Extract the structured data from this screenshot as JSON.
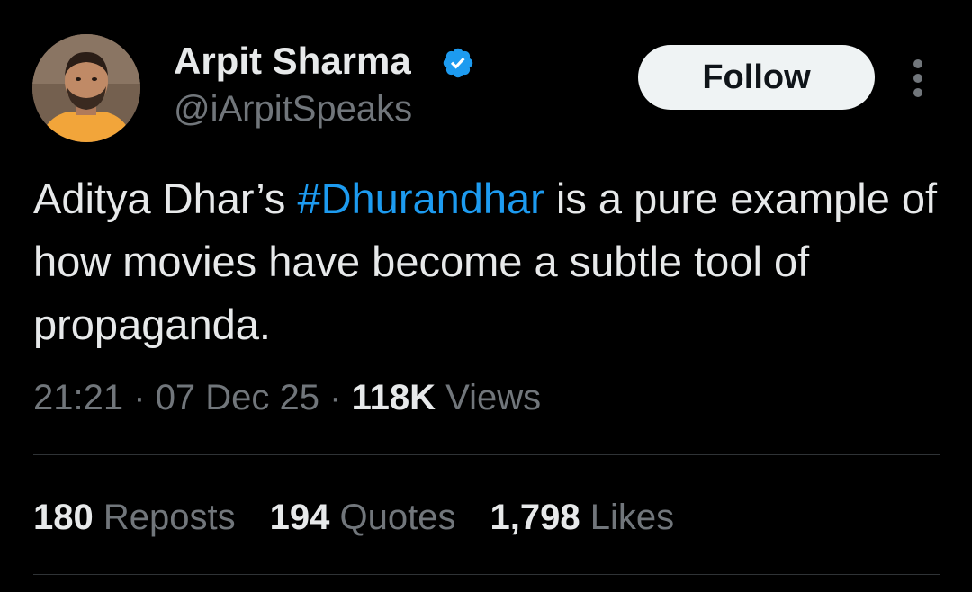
{
  "author": {
    "display_name": "Arpit Sharma",
    "handle": "@iArpitSpeaks",
    "verified": true,
    "verified_color": "#1d9bf0"
  },
  "follow_label": "Follow",
  "tweet": {
    "text_before": "Aditya Dhar’s ",
    "hashtag": "#Dhurandhar",
    "text_after": " is a pure example of how movies have become a subtle tool of propaganda."
  },
  "meta": {
    "time": "21:21",
    "date": "07 Dec 25",
    "views_count": "118K",
    "views_label": "Views",
    "separator": "·"
  },
  "stats": {
    "reposts_count": "180",
    "reposts_label": "Reposts",
    "quotes_count": "194",
    "quotes_label": "Quotes",
    "likes_count": "1,798",
    "likes_label": "Likes"
  },
  "colors": {
    "background": "#000000",
    "primary_text": "#e7e9ea",
    "secondary_text": "#71767b",
    "link": "#1d9bf0",
    "divider": "#2f3336",
    "button_bg": "#eff3f4"
  }
}
